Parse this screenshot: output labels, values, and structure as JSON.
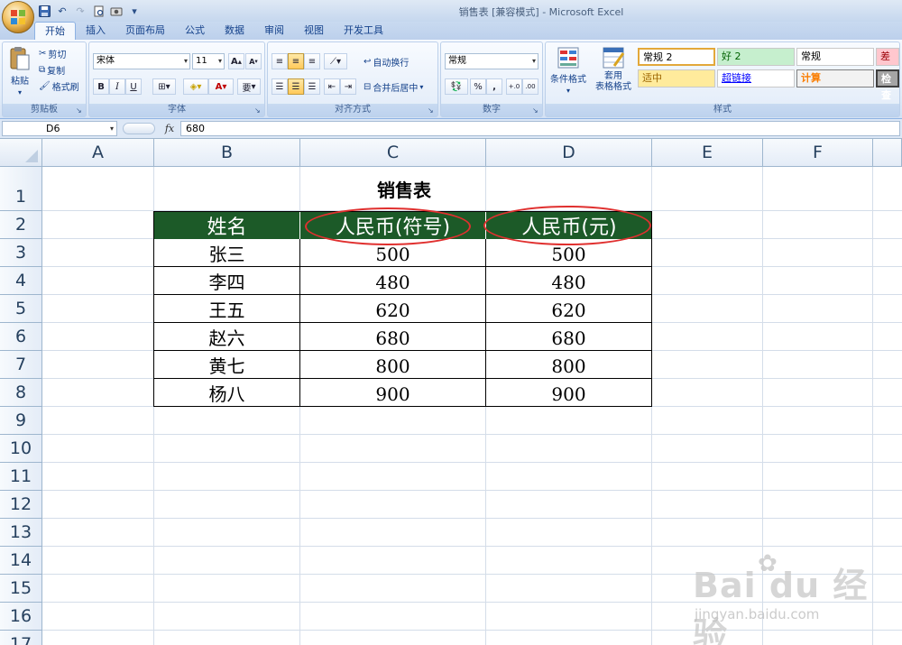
{
  "window": {
    "title": "销售表  [兼容模式] - Microsoft Excel"
  },
  "qat": {
    "save_icon": "save-icon",
    "undo": "↶",
    "redo": "↷",
    "more": "▾"
  },
  "tabs": [
    "开始",
    "插入",
    "页面布局",
    "公式",
    "数据",
    "审阅",
    "视图",
    "开发工具"
  ],
  "ribbon": {
    "clipboard": {
      "label": "剪贴板",
      "paste": "粘贴",
      "cut": "剪切",
      "copy": "复制",
      "format_painter": "格式刷"
    },
    "font": {
      "label": "字体",
      "font_name": "宋体",
      "font_size": "11",
      "bold": "B",
      "italic": "I",
      "underline": "U",
      "font_color": "A",
      "phonetic": "要"
    },
    "alignment": {
      "label": "对齐方式",
      "wrap": "自动换行",
      "merge": "合并后居中"
    },
    "number": {
      "label": "数字",
      "format": "常规",
      "percent": "%",
      "comma": ",",
      "inc_dec": "+.0 .00",
      "dec_dec": ".00 +.0"
    },
    "styles": {
      "label": "样式",
      "conditional": "条件格式",
      "table_format": "套用\n表格格式",
      "cells": [
        {
          "text": "常规 2",
          "bg": "#ffffff",
          "color": "#000000"
        },
        {
          "text": "好 2",
          "bg": "#c6efce",
          "color": "#006100"
        },
        {
          "text": "常规",
          "bg": "#ffffff",
          "color": "#000000"
        },
        {
          "text": "差",
          "bg": "#ffc7ce",
          "color": "#9c0006"
        },
        {
          "text": "适中",
          "bg": "#ffeb9c",
          "color": "#9c6500"
        },
        {
          "text": "超链接",
          "bg": "#ffffff",
          "color": "#0000ff"
        },
        {
          "text": "计算",
          "bg": "#f2f2f2",
          "color": "#fa7d00"
        },
        {
          "text": "检查",
          "bg": "#a5a5a5",
          "color": "#ffffff"
        }
      ]
    }
  },
  "formula_bar": {
    "name_box": "D6",
    "fx": "fx",
    "value": "680"
  },
  "columns": [
    "A",
    "B",
    "C",
    "D",
    "E",
    "F"
  ],
  "rows": [
    "1",
    "2",
    "3",
    "4",
    "5",
    "6",
    "7",
    "8",
    "9",
    "10",
    "11",
    "12",
    "13",
    "14",
    "15",
    "16",
    "17"
  ],
  "sheet": {
    "title": "销售表",
    "headers": [
      "姓名",
      "人民币(符号)",
      "人民币(元)"
    ],
    "data": [
      [
        "张三",
        "500",
        "500"
      ],
      [
        "李四",
        "480",
        "480"
      ],
      [
        "王五",
        "620",
        "620"
      ],
      [
        "赵六",
        "680",
        "680"
      ],
      [
        "黄七",
        "800",
        "800"
      ],
      [
        "杨八",
        "900",
        "900"
      ]
    ]
  },
  "watermark": {
    "main": "Bai du 经验",
    "sub": "jingyan.baidu.com"
  },
  "colors": {
    "header_green": "#1c5a28",
    "annotation_red": "#e0302f"
  }
}
